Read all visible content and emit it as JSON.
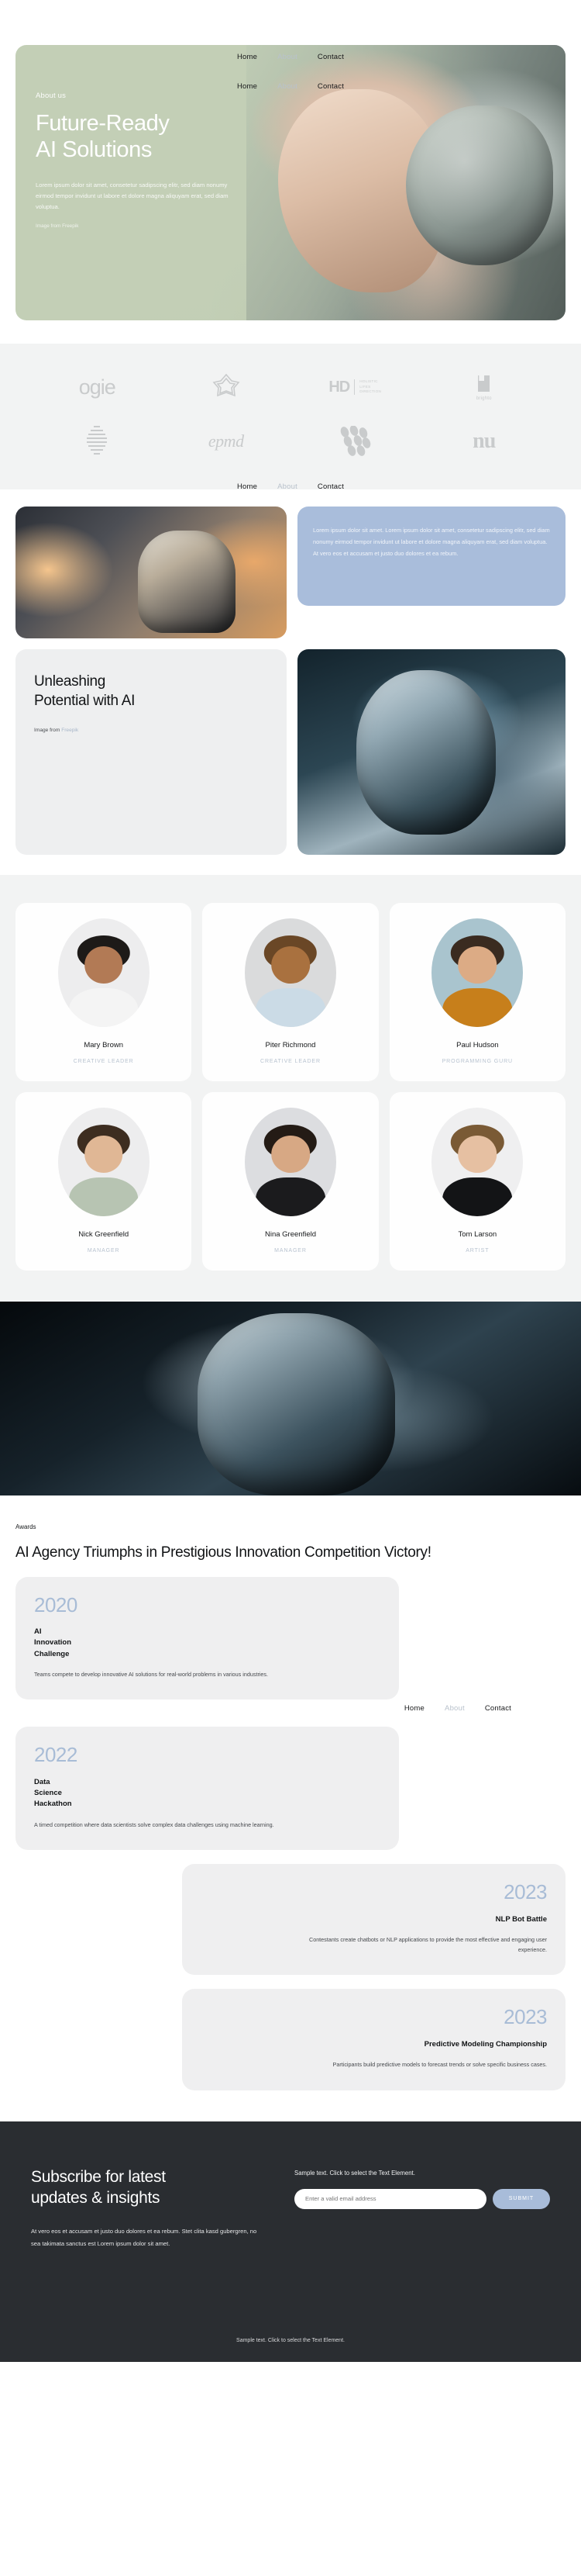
{
  "nav": {
    "items": [
      {
        "label": "Home",
        "active": true
      },
      {
        "label": "About",
        "active": false
      },
      {
        "label": "Contact",
        "active": true
      }
    ]
  },
  "hero": {
    "kicker": "About us",
    "title_line1": "Future-Ready",
    "title_line2": "AI Solutions",
    "text": "Lorem ipsum dolor sit amet, consetetur sadipscing elitr, sed diam nonumy eirmod tempor invidunt ut labore et dolore magna aliquyam erat, sed diam voluptua.",
    "credit": "Image from Freepik",
    "bg_start": "#c2cfb5",
    "bg_end": "#6e7a74"
  },
  "logos": {
    "items": [
      {
        "name": "ogie",
        "type": "wordmark"
      },
      {
        "name": "flower-mark",
        "type": "glyph"
      },
      {
        "name": "HD",
        "sub": "HOLISTIC\nLIFES\nDIRECTION",
        "type": "lockup"
      },
      {
        "name": "brighto",
        "type": "stack"
      },
      {
        "name": "striped-oval",
        "type": "glyph"
      },
      {
        "name": "epmd",
        "type": "wordmark"
      },
      {
        "name": "dots-cluster",
        "type": "glyph"
      },
      {
        "name": "nu",
        "type": "wordmark"
      }
    ],
    "color": "#c9cbcc"
  },
  "section2": {
    "blue_card_text": "Lorem ipsum dolor sit amet. Lorem ipsum dolor sit amet, consetetur sadipscing elitr, sed diam nonumy eirmod tempor invidunt ut labore et dolore magna aliquyam erat, sed diam voluptua. At vero eos et accusam et justo duo dolores et ea rebum.",
    "blue_card_color": "#a9bddb",
    "heading_line1": "Unleashing",
    "heading_line2": "Potential with AI",
    "credit_prefix": "Image from ",
    "credit_link": "Freepik"
  },
  "team": {
    "members": [
      {
        "name": "Mary Brown",
        "role": "CREATIVE LEADER",
        "hair": "#1d1a18",
        "skin": "#b27a55",
        "shirt": "#f4f4f4",
        "bg": "#ededee"
      },
      {
        "name": "Piter Richmond",
        "role": "CREATIVE LEADER",
        "hair": "#6a4726",
        "skin": "#a9713f",
        "shirt": "#cbdbe6",
        "bg": "#dadbdc"
      },
      {
        "name": "Paul Hudson",
        "role": "PROGRAMMING GURU",
        "hair": "#3a2b20",
        "skin": "#dcab85",
        "shirt": "#c77f1b",
        "bg": "#a9c4ce"
      },
      {
        "name": "Nick Greenfield",
        "role": "MANAGER",
        "hair": "#3d2d20",
        "skin": "#e0b795",
        "shirt": "#b7c4b2",
        "bg": "#ededee"
      },
      {
        "name": "Nina Greenfield",
        "role": "MANAGER",
        "hair": "#241b15",
        "skin": "#d7a884",
        "shirt": "#1b1b1d",
        "bg": "#dcdde0"
      },
      {
        "name": "Tom Larson",
        "role": "ARTIST",
        "hair": "#7a5a35",
        "skin": "#e6c0a2",
        "shirt": "#131416",
        "bg": "#efeff0"
      }
    ]
  },
  "awards": {
    "kicker": "Awards",
    "title": "AI Agency Triumphs in Prestigious Innovation Competition Victory!",
    "year_color": "#a8bcd6",
    "items": [
      {
        "year": "2020",
        "name": "AI\nInnovation\nChallenge",
        "desc": "Teams compete to develop innovative AI solutions for real-world problems in various industries.",
        "align": "left"
      },
      {
        "year": "2022",
        "name": "Data\nScience\nHackathon",
        "desc": "A timed competition where data scientists solve complex data challenges using machine learning.",
        "align": "left"
      },
      {
        "year": "2023",
        "name": "NLP Bot Battle",
        "desc": "Contestants create chatbots or NLP applications to provide the most effective and engaging user experience.",
        "align": "right"
      },
      {
        "year": "2023",
        "name": "Predictive Modeling Championship",
        "desc": "Participants build predictive models to forecast trends or solve specific business cases.",
        "align": "right"
      }
    ]
  },
  "footer": {
    "heading_line1": "Subscribe for latest",
    "heading_line2": "updates & insights",
    "paragraph": "At vero eos et accusam et justo duo dolores et ea rebum. Stet clita kasd gubergren, no sea takimata sanctus est Lorem ipsum dolor sit amet.",
    "sample_text": "Sample text. Click to select the Text Element.",
    "email_placeholder": "Enter a valid email address",
    "submit_label": "SUBMIT",
    "bottom_text": "Sample text. Click to select the Text Element.",
    "bg": "#2a2d31",
    "accent": "#a8bcd9"
  }
}
